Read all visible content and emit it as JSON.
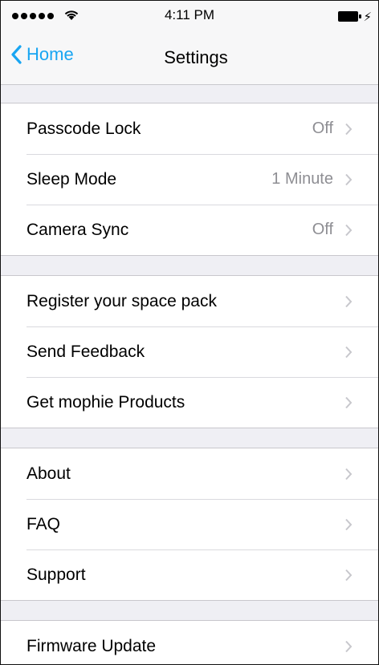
{
  "status_bar": {
    "time": "4:11 PM",
    "icons": [
      "signal-dots-icon",
      "wifi-icon",
      "battery-icon",
      "charging-bolt-icon"
    ]
  },
  "nav": {
    "back_label": "Home",
    "title": "Settings"
  },
  "accent_color": "#18a5f2",
  "groups": [
    {
      "rows": [
        {
          "label": "Passcode Lock",
          "value": "Off"
        },
        {
          "label": "Sleep Mode",
          "value": "1 Minute"
        },
        {
          "label": "Camera Sync",
          "value": "Off"
        }
      ]
    },
    {
      "rows": [
        {
          "label": "Register your space pack"
        },
        {
          "label": "Send Feedback"
        },
        {
          "label": "Get mophie Products"
        }
      ]
    },
    {
      "rows": [
        {
          "label": "About"
        },
        {
          "label": "FAQ"
        },
        {
          "label": "Support"
        }
      ]
    },
    {
      "rows": [
        {
          "label": "Firmware Update"
        }
      ]
    }
  ]
}
